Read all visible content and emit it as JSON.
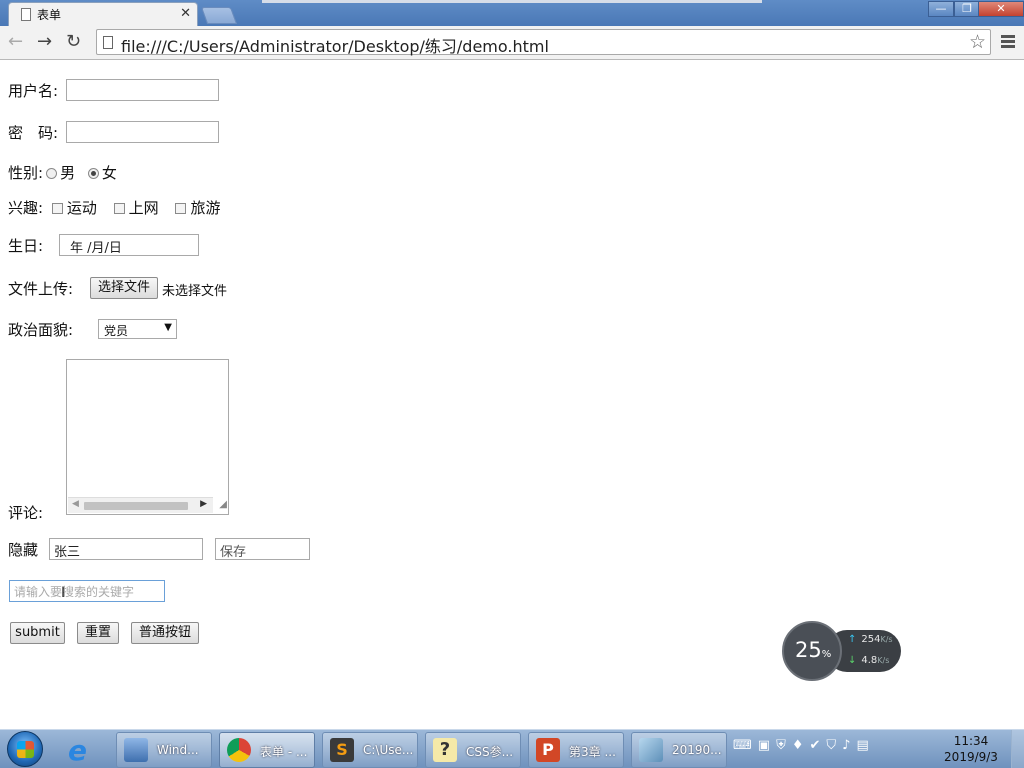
{
  "browser": {
    "tab_title": "表单",
    "url": "file:///C:/Users/Administrator/Desktop/练习/demo.html"
  },
  "form": {
    "username_label": "用户名:",
    "password_label": "密　码:",
    "gender_label": "性别:",
    "gender_options": [
      "男",
      "女"
    ],
    "gender_selected": "女",
    "hobby_label": "兴趣:",
    "hobby_options": [
      "运动",
      "上网",
      "旅游"
    ],
    "birthday_label": "生日:",
    "birthday_placeholder": "年 /月/日",
    "upload_label": "文件上传:",
    "choose_file_button": "选择文件",
    "no_file_text": "未选择文件",
    "political_label": "政治面貌:",
    "political_selected": "党员",
    "comment_label": "评论:",
    "hidden_label": "隐藏",
    "hidden_value": "张三",
    "save_placeholder": "保存",
    "search_placeholder": "请输入要搜索的关键字",
    "submit_button": "submit",
    "reset_button": "重置",
    "normal_button": "普通按钮"
  },
  "net_widget": {
    "percent": "25",
    "percent_unit": "%",
    "upload_speed": "254",
    "download_speed": "4.8",
    "speed_unit": "K/s"
  },
  "taskbar": {
    "items": [
      {
        "label": "Wind...",
        "icon": "computer-icon"
      },
      {
        "label": "表单 - ...",
        "icon": "chrome-icon"
      },
      {
        "label": "C:\\Use...",
        "icon": "sublime-icon"
      },
      {
        "label": "CSS参...",
        "icon": "help-icon"
      },
      {
        "label": "第3章 ...",
        "icon": "powerpoint-icon"
      },
      {
        "label": "20190...",
        "icon": "notebook-icon"
      }
    ],
    "time": "11:34",
    "date": "2019/9/3"
  }
}
